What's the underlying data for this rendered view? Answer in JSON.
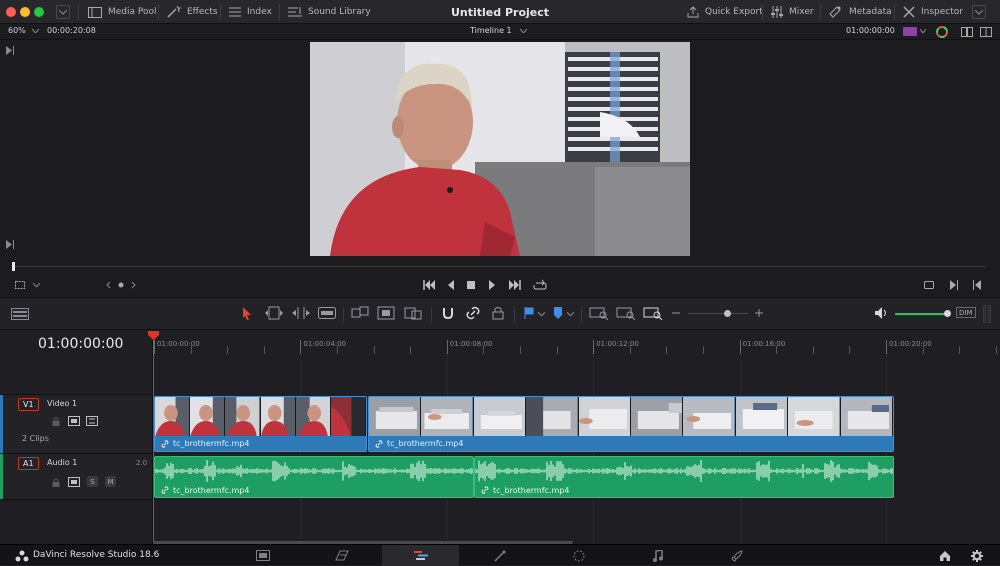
{
  "titlebar": {
    "project_title": "Untitled Project",
    "media_pool": "Media Pool",
    "effects": "Effects",
    "index": "Index",
    "sound_library": "Sound Library",
    "quick_export": "Quick Export",
    "mixer": "Mixer",
    "metadata": "Metadata",
    "inspector": "Inspector"
  },
  "viewer_bar": {
    "zoom": "60%",
    "source_timecode": "00:00:20:08",
    "timeline_name": "Timeline 1",
    "record_timecode": "01:00:00:00"
  },
  "timeline": {
    "current_timecode": "01:00:00:00",
    "ruler_labels": [
      "01:00:00:00",
      "01:00:04:00",
      "01:00:08:00",
      "01:00:12:00",
      "01:00:16:00",
      "01:00:20:00"
    ]
  },
  "tracks": {
    "video": {
      "badge": "V1",
      "name": "Video 1",
      "clip_count": "2 Clips",
      "clips": [
        {
          "name": "tc_brothermfc.mp4"
        },
        {
          "name": "tc_brothermfc.mp4"
        }
      ]
    },
    "audio": {
      "badge": "A1",
      "name": "Audio 1",
      "channels": "2.0",
      "solo": "S",
      "mute": "M",
      "clips": [
        {
          "name": "tc_brothermfc.mp4"
        },
        {
          "name": "tc_brothermfc.mp4"
        }
      ]
    }
  },
  "audio_meter": {
    "dim_label": "DIM"
  },
  "app": {
    "name": "DaVinci Resolve Studio 18.6"
  },
  "colors": {
    "accent_blue": "#2e7ab8",
    "audio_green": "#1e9e62",
    "playhead": "#e0352b",
    "volume_green": "#27c45e"
  }
}
